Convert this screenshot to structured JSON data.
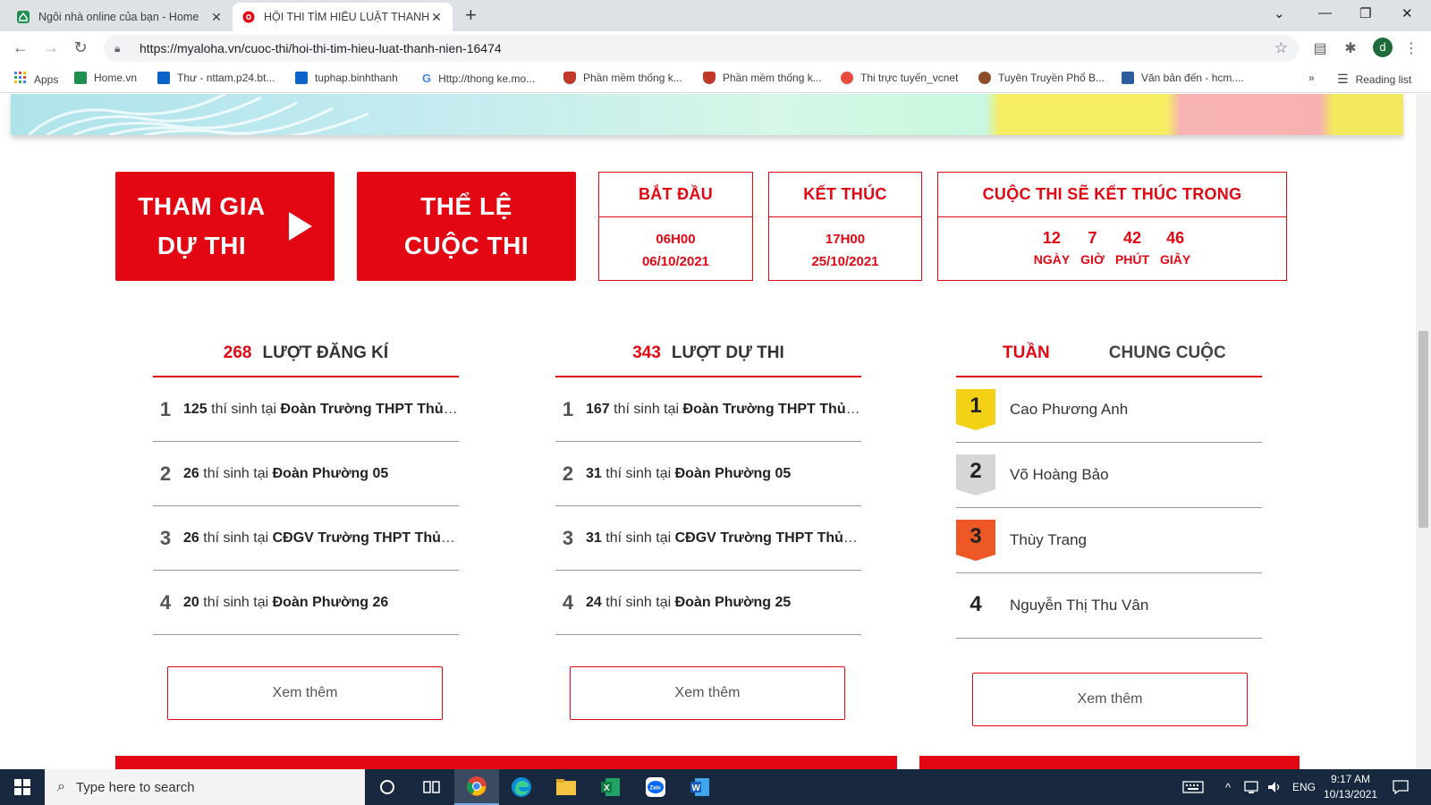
{
  "browser": {
    "tabs": [
      {
        "title": "Ngôi nhà online của bạn - Home",
        "active": false
      },
      {
        "title": "HỘI THI TÌM HIỂU LUẬT THANH",
        "active": true
      }
    ],
    "url": "https://myaloha.vn/cuoc-thi/hoi-thi-tim-hieu-luat-thanh-nien-16474",
    "profile_initial": "d",
    "bookmarks": [
      {
        "label": "Apps",
        "icon": "apps-grid-icon",
        "color": "#4285f4"
      },
      {
        "label": "Home.vn",
        "icon": "home-icon",
        "color": "#1e8f4e"
      },
      {
        "label": "Thư - nttam.p24.bt...",
        "icon": "outlook-icon",
        "color": "#0a64c8"
      },
      {
        "label": "tuphap.binhthanh",
        "icon": "outlook-icon",
        "color": "#0a64c8"
      },
      {
        "label": "Http://thong ke.mo...",
        "icon": "google-icon",
        "color": "#4285f4"
      },
      {
        "label": "Phần mềm thống k...",
        "icon": "shield-icon",
        "color": "#c0392b"
      },
      {
        "label": "Phần mềm thống k...",
        "icon": "shield-icon",
        "color": "#c0392b"
      },
      {
        "label": "Thi trực tuyến_vcnet",
        "icon": "swirl-icon",
        "color": "#e74c3c"
      },
      {
        "label": "Tuyên Truyền Phổ B...",
        "icon": "badge-icon",
        "color": "#8e4e2b"
      },
      {
        "label": "Văn bản đến - hcm....",
        "icon": "document-icon",
        "color": "#2c5d9e"
      }
    ],
    "overflow": "»",
    "reading_list": "Reading list"
  },
  "contest": {
    "join_button": {
      "line1": "THAM GIA",
      "line2": "DỰ THI"
    },
    "rules_button": {
      "line1": "THỂ LỆ",
      "line2": "CUỘC THI"
    },
    "start": {
      "label": "BẮT ĐẦU",
      "time": "06H00",
      "date": "06/10/2021"
    },
    "end": {
      "label": "KẾT THÚC",
      "time": "17H00",
      "date": "25/10/2021"
    },
    "countdown": {
      "label": "CUỘC THI SẼ KẾT THÚC TRONG",
      "items": [
        {
          "value": "12",
          "unit": "NGÀY"
        },
        {
          "value": "7",
          "unit": "GIỜ"
        },
        {
          "value": "42",
          "unit": "PHÚT"
        },
        {
          "value": "46",
          "unit": "GIÂY"
        }
      ]
    }
  },
  "registrations": {
    "count": "268",
    "label": "LƯỢT ĐĂNG KÍ",
    "rows": [
      {
        "rank": "1",
        "num": "125",
        "mid": " thí sinh tại ",
        "org": "Đoàn Trường THPT Thủ Thiêm"
      },
      {
        "rank": "2",
        "num": "26",
        "mid": " thí sinh tại ",
        "org": "Đoàn Phường 05"
      },
      {
        "rank": "3",
        "num": "26",
        "mid": " thí sinh tại ",
        "org": "CĐGV Trường THPT Thủ Thiêm"
      },
      {
        "rank": "4",
        "num": "20",
        "mid": " thí sinh tại ",
        "org": "Đoàn Phường 26"
      }
    ],
    "more": "Xem thêm"
  },
  "submissions": {
    "count": "343",
    "label": "LƯỢT DỰ THI",
    "rows": [
      {
        "rank": "1",
        "num": "167",
        "mid": " thí sinh tại ",
        "org": "Đoàn Trường THPT Thủ Thiêm"
      },
      {
        "rank": "2",
        "num": "31",
        "mid": " thí sinh tại ",
        "org": "Đoàn Phường 05"
      },
      {
        "rank": "3",
        "num": "31",
        "mid": " thí sinh tại ",
        "org": "CĐGV Trường THPT Thủ Thiêm"
      },
      {
        "rank": "4",
        "num": "24",
        "mid": " thí sinh tại ",
        "org": "Đoàn Phường 25"
      }
    ],
    "more": "Xem thêm"
  },
  "leaderboard": {
    "tab_week": "TUẦN",
    "tab_overall": "CHUNG CUỘC",
    "rows": [
      {
        "rank": "1",
        "name": "Cao Phương Anh"
      },
      {
        "rank": "2",
        "name": "Võ Hoàng Bảo"
      },
      {
        "rank": "3",
        "name": "Thùy Trang"
      },
      {
        "rank": "4",
        "name": "Nguyễn Thị Thu Vân"
      }
    ],
    "more": "Xem thêm"
  },
  "taskbar": {
    "search_placeholder": "Type here to search",
    "language": "ENG",
    "time": "9:17 AM",
    "date": "10/13/2021"
  },
  "colors": {
    "accent_red": "#e30613",
    "gold": "#f2d116",
    "silver": "#d6d6d6",
    "bronze": "#ee5726"
  }
}
